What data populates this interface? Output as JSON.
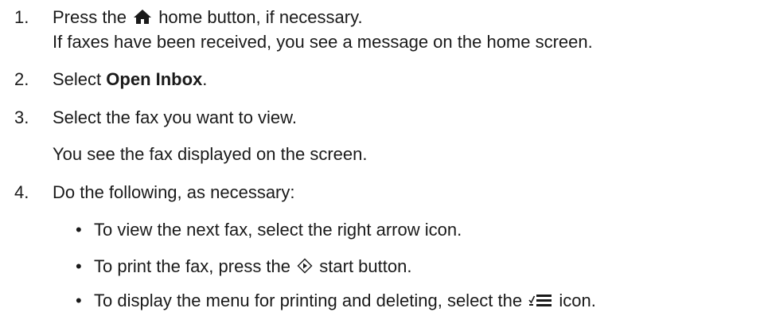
{
  "steps": [
    {
      "number": "1.",
      "pre": "Press the",
      "icon": "home-icon",
      "post": "home button, if necessary.",
      "note": "If faxes have been received, you see a message on the home screen."
    },
    {
      "number": "2.",
      "pre": "Select",
      "bold": "Open Inbox",
      "post": "."
    },
    {
      "number": "3.",
      "text": "Select the fax you want to view.",
      "note": "You see the fax displayed on the screen."
    },
    {
      "number": "4.",
      "text": "Do the following, as necessary:",
      "bullets": [
        {
          "text": "To view the next fax, select the right arrow icon."
        },
        {
          "pre": "To print the fax, press the",
          "icon": "start-icon",
          "post": "start button."
        },
        {
          "pre": "To display the menu for printing and deleting, select the",
          "icon": "menu-check-list-icon",
          "post": "icon."
        }
      ]
    }
  ]
}
